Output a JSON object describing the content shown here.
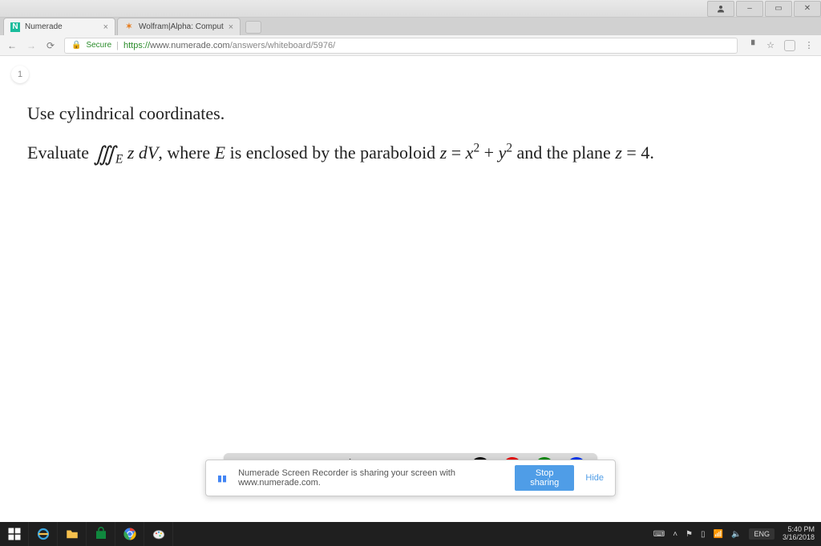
{
  "window_controls": {
    "user": "user-icon",
    "minimize": "–",
    "maximize": "▭",
    "close": "✕"
  },
  "tabs": [
    {
      "title": "Numerade",
      "favicon": "N",
      "active": true
    },
    {
      "title": "Wolfram|Alpha: Comput",
      "favicon": "✶",
      "active": false
    }
  ],
  "address": {
    "secure_label": "Secure",
    "protocol": "https://",
    "host": "www.numerade.com",
    "path": "/answers/whiteboard/5976/"
  },
  "page": {
    "badge": "1",
    "line1": "Use cylindrical coordinates.",
    "line2_prefix": "Evaluate ",
    "integral_symbol": "∭",
    "integral_sub": "E",
    "integrand": " z dV",
    "line2_mid": ", where ",
    "region_var": "E",
    "line2_mid2": " is enclosed by the paraboloid ",
    "eq1_lhs": "z",
    "eq1_eq": " = ",
    "eq1_rhs_a": "x",
    "eq1_rhs_a_sup": "2",
    "eq1_plus": " + ",
    "eq1_rhs_b": "y",
    "eq1_rhs_b_sup": "2",
    "line2_mid3": " and the plane ",
    "eq2_lhs": "z",
    "eq2_eq": " = ",
    "eq2_rhs": "4",
    "line2_end": "."
  },
  "whiteboard_tools": {
    "undo": "undo-icon",
    "redo": "redo-icon",
    "pointer": "pointer-icon",
    "pen": "pen-icon",
    "add": "plus-icon",
    "eraser": "eraser-icon",
    "text": "text-icon",
    "color_black": "#000000",
    "color_red": "#e60000",
    "color_green": "#008800",
    "color_blue": "#0033ee"
  },
  "share_popup": {
    "message": "Numerade Screen Recorder is sharing your screen with www.numerade.com.",
    "stop_label": "Stop sharing",
    "hide_label": "Hide"
  },
  "taskbar": {
    "keyboard_label": "⌨",
    "lang": "ENG",
    "time": "5:40 PM",
    "date": "3/16/2018"
  }
}
